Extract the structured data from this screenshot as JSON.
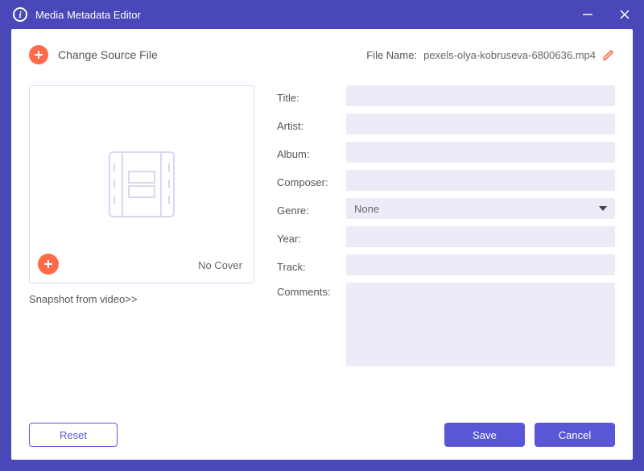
{
  "window": {
    "title": "Media Metadata Editor"
  },
  "topbar": {
    "change_source_label": "Change Source File",
    "filename_label": "File Name:",
    "filename_value": "pexels-olya-kobruseva-6800636.mp4"
  },
  "cover": {
    "no_cover_label": "No Cover",
    "snapshot_link": "Snapshot from video>>"
  },
  "fields": {
    "title": {
      "label": "Title:",
      "value": ""
    },
    "artist": {
      "label": "Artist:",
      "value": ""
    },
    "album": {
      "label": "Album:",
      "value": ""
    },
    "composer": {
      "label": "Composer:",
      "value": ""
    },
    "genre": {
      "label": "Genre:",
      "selected": "None"
    },
    "year": {
      "label": "Year:",
      "value": ""
    },
    "track": {
      "label": "Track:",
      "value": ""
    },
    "comments": {
      "label": "Comments:",
      "value": ""
    }
  },
  "buttons": {
    "reset": "Reset",
    "save": "Save",
    "cancel": "Cancel"
  }
}
